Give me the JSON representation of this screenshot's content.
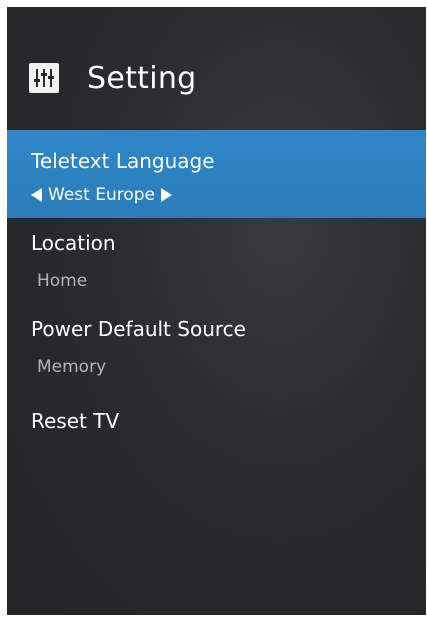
{
  "header": {
    "title": "Setting",
    "icon": "settings-sliders-icon"
  },
  "menu": {
    "items": [
      {
        "label": "Teletext Language",
        "value": "West Europe",
        "selected": true
      },
      {
        "label": "Location",
        "value": "Home",
        "selected": false
      },
      {
        "label": "Power Default Source",
        "value": "Memory",
        "selected": false
      },
      {
        "label": "Reset TV",
        "selected": false
      }
    ]
  },
  "colors": {
    "highlight": "#2f87c7",
    "background": "#2b2b2f",
    "text": "#ffffff",
    "muted": "#b5b5b8"
  }
}
